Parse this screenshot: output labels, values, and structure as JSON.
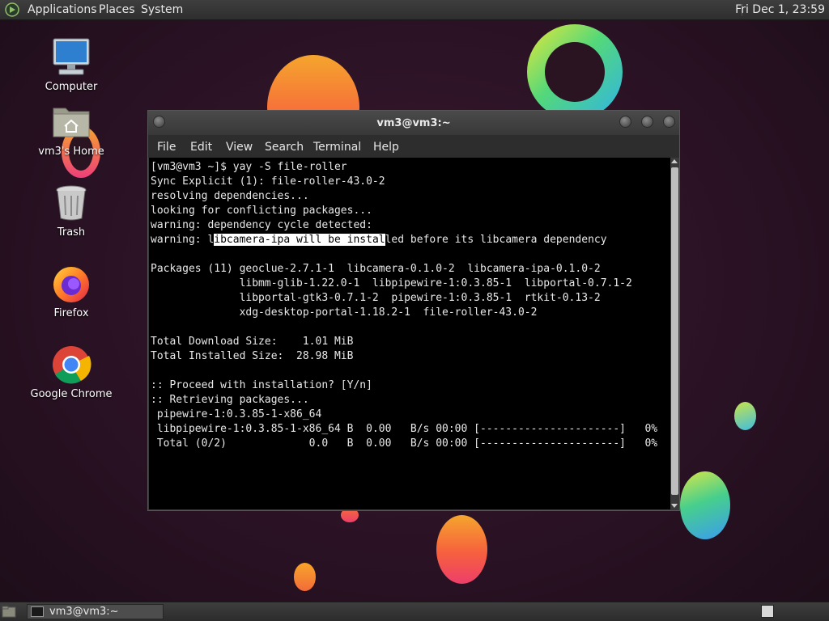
{
  "top_panel": {
    "menus": [
      "Applications",
      "Places",
      "System"
    ],
    "clock": "Fri Dec 1, 23:59"
  },
  "desktop_icons": {
    "computer": "Computer",
    "home": "vm3's Home",
    "trash": "Trash",
    "firefox": "Firefox",
    "chrome": "Google Chrome"
  },
  "terminal": {
    "title": "vm3@vm3:~",
    "menu": [
      "File",
      "Edit",
      "View",
      "Search",
      "Terminal",
      "Help"
    ],
    "lines": {
      "l1": "[vm3@vm3 ~]$ yay -S file-roller",
      "l2": "Sync Explicit (1): file-roller-43.0-2",
      "l3": "resolving dependencies...",
      "l4": "looking for conflicting packages...",
      "l5": "warning: dependency cycle detected:",
      "l6_pre": "warning: l",
      "l6_sel": "ibcamera-ipa will be instal",
      "l6_post": "led before its libcamera dependency",
      "l7": "",
      "l8": "Packages (11) geoclue-2.7.1-1  libcamera-0.1.0-2  libcamera-ipa-0.1.0-2",
      "l9": "              libmm-glib-1.22.0-1  libpipewire-1:0.3.85-1  libportal-0.7.1-2",
      "l10": "              libportal-gtk3-0.7.1-2  pipewire-1:0.3.85-1  rtkit-0.13-2",
      "l11": "              xdg-desktop-portal-1.18.2-1  file-roller-43.0-2",
      "l12": "",
      "l13": "Total Download Size:    1.01 MiB",
      "l14": "Total Installed Size:  28.98 MiB",
      "l15": "",
      "l16": ":: Proceed with installation? [Y/n]",
      "l17": ":: Retrieving packages...",
      "l18": " pipewire-1:0.3.85-1-x86_64",
      "l19": " libpipewire-1:0.3.85-1-x86_64 B  0.00   B/s 00:00 [----------------------]   0%",
      "l20": " Total (0/2)             0.0   B  0.00   B/s 00:00 [----------------------]   0%"
    }
  },
  "bottom_panel": {
    "task_label": "vm3@vm3:~"
  }
}
